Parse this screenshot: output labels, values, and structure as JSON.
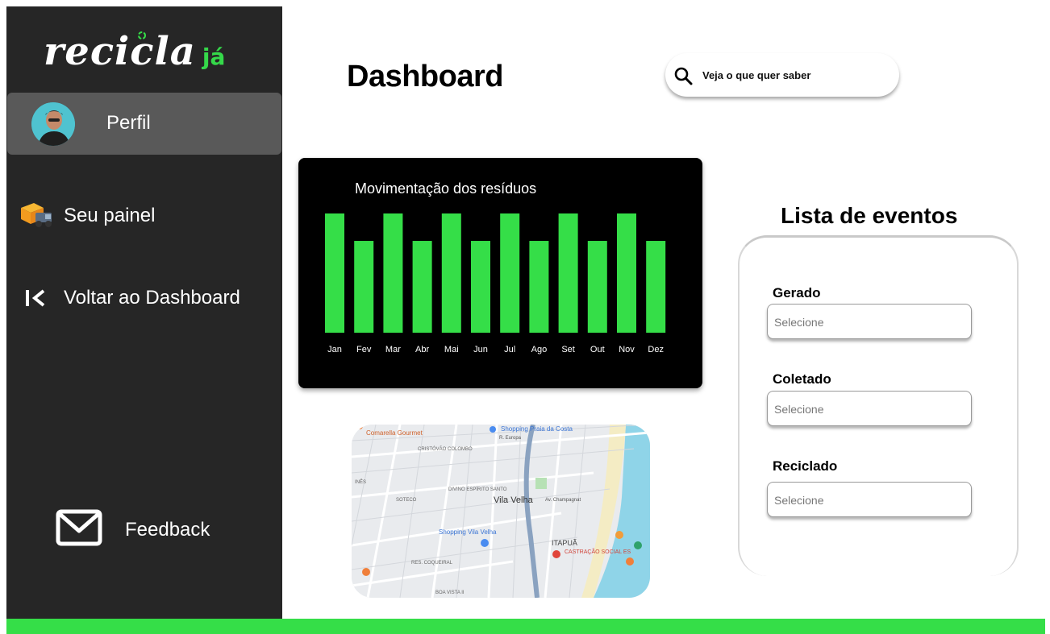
{
  "sidebar": {
    "logo": {
      "main": "recicla",
      "accent": "já"
    },
    "profile_label": "Perfil",
    "items": [
      {
        "label": "Seu painel",
        "icon": "delivery-truck-icon"
      },
      {
        "label": "Voltar ao Dashboard",
        "icon": "back-chevron-icon"
      }
    ],
    "feedback": {
      "label": "Feedback",
      "icon": "mail-icon"
    }
  },
  "header": {
    "title": "Dashboard",
    "search_placeholder": "Veja o que quer saber"
  },
  "chart_data": {
    "type": "bar",
    "title": "Movimentação dos resíduos",
    "categories": [
      "Jan",
      "Fev",
      "Mar",
      "Abr",
      "Mai",
      "Jun",
      "Jul",
      "Ago",
      "Set",
      "Out",
      "Nov",
      "Dez"
    ],
    "values": [
      100,
      77,
      100,
      77,
      100,
      77,
      100,
      77,
      100,
      77,
      100,
      77
    ],
    "ylim": [
      0,
      100
    ],
    "bar_color": "#35de48",
    "background": "#000000"
  },
  "map": {
    "labels": [
      "Comarella Gourmet",
      "Shopping Praia da Costa",
      "CRISTÓVÃO COLOMBO",
      "DIVINO ESPÍRITO SANTO",
      "Vila Velha",
      "SOTECO",
      "Shopping Vila Velha",
      "ITAPUÃ",
      "CASTRAÇÃO SOCIAL ES",
      "RES. COQUEIRAL",
      "BOA VISTA II",
      "INÊS",
      "Av. Champagnat",
      "R. Europa"
    ]
  },
  "events": {
    "title": "Lista de eventos",
    "fields": [
      {
        "label": "Gerado",
        "placeholder": "Selecione"
      },
      {
        "label": "Coletado",
        "placeholder": "Selecione"
      },
      {
        "label": "Reciclado",
        "placeholder": "Selecione"
      }
    ]
  },
  "colors": {
    "accent": "#35de48",
    "sidebar": "#262626",
    "profile_bg": "#595959"
  }
}
